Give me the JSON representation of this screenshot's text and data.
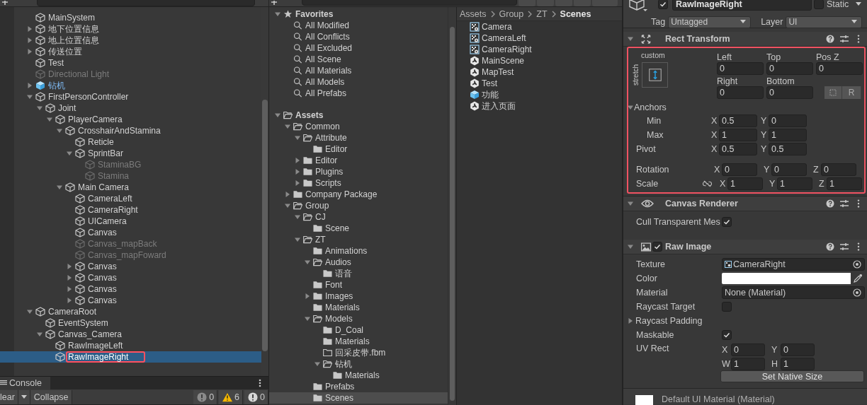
{
  "hierarchy": {
    "items": [
      {
        "name": "MainSystem",
        "kind": "object",
        "active": true,
        "selected": false
      },
      {
        "name": "地下位置信息",
        "kind": "object",
        "active": true,
        "selected": false,
        "expanded": false
      },
      {
        "name": "地上位置信息",
        "kind": "object",
        "active": true,
        "selected": false,
        "expanded": false
      },
      {
        "name": "传送位置",
        "kind": "object",
        "active": true,
        "selected": false,
        "expanded": false
      },
      {
        "name": "Test",
        "kind": "object",
        "active": true,
        "selected": false
      },
      {
        "name": "Directional Light",
        "kind": "object",
        "active": false,
        "selected": false
      },
      {
        "name": "钻机",
        "kind": "prefab",
        "active": true,
        "selected": false,
        "expanded": false
      },
      {
        "name": "FirstPersonController",
        "kind": "object",
        "active": true,
        "selected": false,
        "expanded": true,
        "children": [
          {
            "name": "Joint",
            "kind": "object",
            "active": true,
            "selected": false,
            "expanded": true,
            "children": [
              {
                "name": "PlayerCamera",
                "kind": "object",
                "active": true,
                "selected": false,
                "expanded": true,
                "children": [
                  {
                    "name": "CrosshairAndStamina",
                    "kind": "object",
                    "active": true,
                    "selected": false,
                    "expanded": true,
                    "children": [
                      {
                        "name": "Reticle",
                        "kind": "object",
                        "active": true,
                        "selected": false
                      },
                      {
                        "name": "SprintBar",
                        "kind": "object",
                        "active": true,
                        "selected": false,
                        "expanded": true,
                        "children": [
                          {
                            "name": "StaminaBG",
                            "kind": "object",
                            "active": false,
                            "selected": false
                          },
                          {
                            "name": "Stamina",
                            "kind": "object",
                            "active": false,
                            "selected": false
                          }
                        ]
                      }
                    ]
                  },
                  {
                    "name": "Main Camera",
                    "kind": "object",
                    "active": true,
                    "selected": false,
                    "expanded": true,
                    "children": [
                      {
                        "name": "CameraLeft",
                        "kind": "object",
                        "active": true,
                        "selected": false
                      },
                      {
                        "name": "CameraRight",
                        "kind": "object",
                        "active": true,
                        "selected": false
                      },
                      {
                        "name": "UICamera",
                        "kind": "object",
                        "active": true,
                        "selected": false
                      },
                      {
                        "name": "Canvas",
                        "kind": "object",
                        "active": true,
                        "selected": false
                      },
                      {
                        "name": "Canvas_mapBack",
                        "kind": "object",
                        "active": false,
                        "selected": false
                      },
                      {
                        "name": "Canvas_mapFoward",
                        "kind": "object",
                        "active": false,
                        "selected": false
                      },
                      {
                        "name": "Canvas",
                        "kind": "object",
                        "active": true,
                        "selected": false,
                        "expanded": false
                      },
                      {
                        "name": "Canvas",
                        "kind": "object",
                        "active": true,
                        "selected": false,
                        "expanded": false
                      },
                      {
                        "name": "Canvas",
                        "kind": "object",
                        "active": true,
                        "selected": false,
                        "expanded": false
                      },
                      {
                        "name": "Canvas",
                        "kind": "object",
                        "active": true,
                        "selected": false,
                        "expanded": false
                      }
                    ]
                  }
                ]
              }
            ]
          }
        ]
      },
      {
        "name": "CameraRoot",
        "kind": "object",
        "active": true,
        "selected": false,
        "expanded": true,
        "children": [
          {
            "name": "EventSystem",
            "kind": "object",
            "active": true,
            "selected": false
          },
          {
            "name": "Canvas_Camera",
            "kind": "object",
            "active": true,
            "selected": false,
            "expanded": true,
            "children": [
              {
                "name": "RawImageLeft",
                "kind": "object",
                "active": true,
                "selected": false
              },
              {
                "name": "RawImageRight",
                "kind": "object",
                "active": true,
                "selected": true
              }
            ]
          }
        ]
      }
    ]
  },
  "console": {
    "tab": "Console",
    "clear": "lear",
    "collapse": "Collapse",
    "counts": [
      {
        "kind": "info",
        "count": "0"
      },
      {
        "kind": "warning",
        "count": "6"
      },
      {
        "kind": "error",
        "count": "0"
      }
    ]
  },
  "project": {
    "tree": [
      {
        "name": "Favorites",
        "kind": "favorites",
        "selected": false,
        "expanded": true,
        "children": [
          {
            "name": "All Modified",
            "kind": "search",
            "selected": false
          },
          {
            "name": "All Conflicts",
            "kind": "search",
            "selected": false
          },
          {
            "name": "All Excluded",
            "kind": "search",
            "selected": false
          },
          {
            "name": "All Scene",
            "kind": "search",
            "selected": false
          },
          {
            "name": "All Materials",
            "kind": "search",
            "selected": false
          },
          {
            "name": "All Models",
            "kind": "search",
            "selected": false
          },
          {
            "name": "All Prefabs",
            "kind": "search",
            "selected": false
          }
        ]
      },
      {
        "name": "Assets",
        "kind": "folder",
        "selected": false,
        "expanded": true,
        "children": [
          {
            "name": "Common",
            "kind": "folder",
            "selected": false,
            "expanded": true,
            "children": [
              {
                "name": "Attribute",
                "kind": "folder",
                "selected": false,
                "expanded": true,
                "children": [
                  {
                    "name": "Editor",
                    "kind": "folder",
                    "selected": false
                  }
                ]
              },
              {
                "name": "Editor",
                "kind": "folder",
                "selected": false,
                "expanded": false
              },
              {
                "name": "Plugins",
                "kind": "folder",
                "selected": false,
                "expanded": false
              },
              {
                "name": "Scripts",
                "kind": "folder",
                "selected": false,
                "expanded": false
              }
            ]
          },
          {
            "name": "Company Package",
            "kind": "folder",
            "selected": false,
            "expanded": false
          },
          {
            "name": "Group",
            "kind": "folder",
            "selected": false,
            "expanded": true,
            "children": [
              {
                "name": "CJ",
                "kind": "folder",
                "selected": false,
                "expanded": true,
                "children": [
                  {
                    "name": "Scene",
                    "kind": "folder",
                    "selected": false
                  }
                ]
              },
              {
                "name": "ZT",
                "kind": "folder",
                "selected": false,
                "expanded": true,
                "children": [
                  {
                    "name": "Animations",
                    "kind": "folder",
                    "selected": false
                  },
                  {
                    "name": "Audios",
                    "kind": "folder",
                    "selected": false,
                    "expanded": true,
                    "children": [
                      {
                        "name": "语音",
                        "kind": "folder",
                        "selected": false
                      }
                    ]
                  },
                  {
                    "name": "Font",
                    "kind": "folder",
                    "selected": false
                  },
                  {
                    "name": "Images",
                    "kind": "folder",
                    "selected": false,
                    "expanded": false
                  },
                  {
                    "name": "Materials",
                    "kind": "folder",
                    "selected": false
                  },
                  {
                    "name": "Models",
                    "kind": "folder",
                    "selected": false,
                    "expanded": true,
                    "children": [
                      {
                        "name": "D_Coal",
                        "kind": "folder",
                        "selected": false
                      },
                      {
                        "name": "Materials",
                        "kind": "folder",
                        "selected": false
                      },
                      {
                        "name": "回采皮带.fbm",
                        "kind": "empty-folder",
                        "selected": false
                      },
                      {
                        "name": "钻机",
                        "kind": "folder",
                        "selected": false,
                        "expanded": true,
                        "children": [
                          {
                            "name": "Materials",
                            "kind": "folder",
                            "selected": false
                          }
                        ]
                      }
                    ]
                  },
                  {
                    "name": "Prefabs",
                    "kind": "folder",
                    "selected": false
                  },
                  {
                    "name": "Scenes",
                    "kind": "folder",
                    "selected": true
                  }
                ]
              }
            ]
          }
        ]
      }
    ],
    "breadcrumb": [
      {
        "label": "Assets",
        "selected": false
      },
      {
        "label": "Group",
        "selected": false
      },
      {
        "label": "ZT",
        "selected": false
      },
      {
        "label": "Scenes",
        "selected": true
      }
    ],
    "files": [
      {
        "name": "Camera",
        "kind": "render-texture",
        "selected": false
      },
      {
        "name": "CameraLeft",
        "kind": "render-texture",
        "selected": false
      },
      {
        "name": "CameraRight",
        "kind": "render-texture",
        "selected": false
      },
      {
        "name": "MainScene",
        "kind": "scene",
        "selected": false
      },
      {
        "name": "MapTest",
        "kind": "scene",
        "selected": false
      },
      {
        "name": "Test",
        "kind": "scene",
        "selected": false
      },
      {
        "name": "功能",
        "kind": "prefab",
        "selected": false
      },
      {
        "name": "进入页面",
        "kind": "scene",
        "selected": false
      }
    ]
  },
  "inspector": {
    "object": {
      "active": true,
      "name": "RawImageRight",
      "static": false,
      "static_label": "Static",
      "tag_label": "Tag",
      "tag": "Untagged",
      "layer_label": "Layer",
      "layer": "UI"
    },
    "rect_transform": {
      "title": "Rect Transform",
      "outlined": true,
      "preset": "custom",
      "stretch": "stretch",
      "offsets": [
        {
          "label": "Left",
          "value": "0"
        },
        {
          "label": "Top",
          "value": "0"
        },
        {
          "label": "Pos Z",
          "value": "0"
        },
        {
          "label": "Right",
          "value": "0"
        },
        {
          "label": "Bottom",
          "value": "0"
        }
      ],
      "raw_button": "R",
      "anchors": {
        "label": "Anchors",
        "expanded": true,
        "rows": [
          {
            "label": "Min",
            "fields": [
              {
                "axis": "X",
                "value": "0.5"
              },
              {
                "axis": "Y",
                "value": "0"
              }
            ]
          },
          {
            "label": "Max",
            "fields": [
              {
                "axis": "X",
                "value": "1"
              },
              {
                "axis": "Y",
                "value": "1"
              }
            ]
          }
        ]
      },
      "rows": [
        {
          "label": "Pivot",
          "fields": [
            {
              "axis": "X",
              "value": "0.5"
            },
            {
              "axis": "Y",
              "value": "0.5"
            }
          ]
        },
        {
          "label": "Rotation",
          "fields": [
            {
              "axis": "X",
              "value": "0"
            },
            {
              "axis": "Y",
              "value": "0"
            },
            {
              "axis": "Z",
              "value": "0"
            }
          ]
        },
        {
          "label": "Scale",
          "constrained": false,
          "fields": [
            {
              "axis": "X",
              "value": "1"
            },
            {
              "axis": "Y",
              "value": "1"
            },
            {
              "axis": "Z",
              "value": "1"
            }
          ]
        }
      ]
    },
    "canvas_renderer": {
      "title": "Canvas Renderer",
      "props": [
        {
          "kind": "check",
          "label": "Cull Transparent Mes",
          "checked": true
        }
      ]
    },
    "raw_image": {
      "title": "Raw Image",
      "enabled": true,
      "props": [
        {
          "kind": "object",
          "label": "Texture",
          "value": "CameraRight"
        },
        {
          "kind": "color",
          "label": "Color"
        },
        {
          "kind": "object",
          "label": "Material",
          "value": "None (Material)"
        },
        {
          "kind": "check",
          "label": "Raycast Target",
          "checked": false
        },
        {
          "kind": "foldout",
          "label": "Raycast Padding",
          "expanded": false
        },
        {
          "kind": "check",
          "label": "Maskable",
          "checked": true
        },
        {
          "kind": "vector",
          "label": "UV Rect",
          "fields": [
            {
              "axis": "X",
              "value": "0"
            },
            {
              "axis": "Y",
              "value": "0"
            },
            {
              "axis": "W",
              "value": "1"
            },
            {
              "axis": "H",
              "value": "1"
            }
          ]
        }
      ],
      "button": "Set Native Size"
    },
    "material": {
      "name": "Default UI Material (Material)"
    }
  }
}
